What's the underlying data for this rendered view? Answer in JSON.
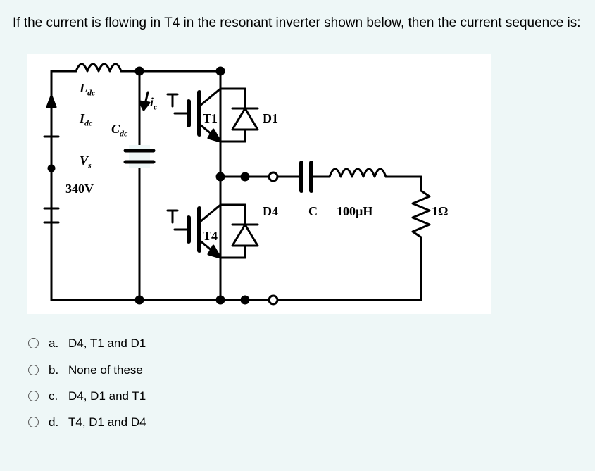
{
  "question": {
    "text": "If the current is flowing in T4 in the resonant inverter shown below, then the current sequence is:"
  },
  "circuit": {
    "Ldc": "L",
    "Ldc_sub": "dc",
    "Idc": "I",
    "Idc_sub": "dc",
    "Cdc": "C",
    "Cdc_sub": "dc",
    "ic": "i",
    "ic_sub": "c",
    "Vs": "V",
    "Vs_sub": "s",
    "Vsrc": "340V",
    "T1": "T1",
    "D1": "D1",
    "T4": "T4",
    "D4": "D4",
    "C2": "C",
    "Lval": "100µH",
    "Rval": "1Ω"
  },
  "options": [
    {
      "letter": "a.",
      "text": "D4, T1 and D1"
    },
    {
      "letter": "b.",
      "text": "None of these"
    },
    {
      "letter": "c.",
      "text": "D4, D1 and T1"
    },
    {
      "letter": "d.",
      "text": "T4, D1 and D4"
    }
  ]
}
